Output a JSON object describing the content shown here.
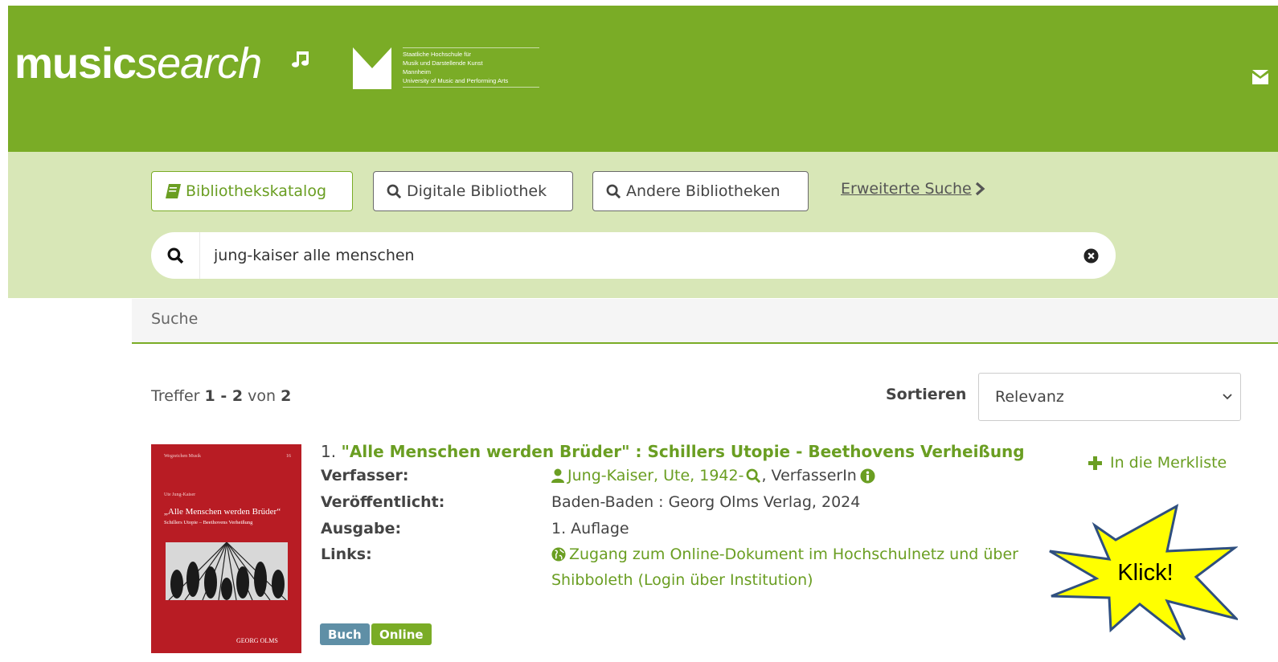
{
  "header": {
    "brand_bold": "music",
    "brand_italic": "search",
    "institution_lines": [
      "Staatliche Hochschule für",
      "Musik und Darstellende Kunst",
      "Mannheim",
      "University of Music and Performing Arts"
    ],
    "brand_color": "#7aac26"
  },
  "tabs": [
    {
      "label": "Bibliothekskatalog",
      "icon": "book-icon",
      "active": true
    },
    {
      "label": "Digitale Bibliothek",
      "icon": "search-icon",
      "active": false
    },
    {
      "label": "Andere Bibliotheken",
      "icon": "search-icon",
      "active": false
    }
  ],
  "advanced_search": "Erweiterte Suche",
  "search": {
    "value": "jung-kaiser alle menschen"
  },
  "breadcrumb": "Suche",
  "results_header": {
    "prefix": "Treffer",
    "range": "1 - 2",
    "of": "von",
    "total": "2",
    "sort_label": "Sortieren",
    "sort_value": "Relevanz"
  },
  "result": {
    "number": "1.",
    "title": "\"Alle Menschen werden Brüder\" : Schillers Utopie - Beethovens Verheißung",
    "fields": {
      "author_label": "Verfasser:",
      "author_name": "Jung-Kaiser, Ute, 1942-",
      "author_role": ", VerfasserIn",
      "published_label": "Veröffentlicht:",
      "published_value": "Baden-Baden : Georg Olms Verlag, 2024",
      "edition_label": "Ausgabe:",
      "edition_value": "1. Auflage",
      "links_label": "Links:",
      "link_line1": "Zugang zum Online-Dokument im Hochschulnetz und über",
      "link_line2": "Shibboleth (Login über Institution)"
    },
    "bookmark": "In die Merkliste",
    "badges": [
      "Buch",
      "Online"
    ],
    "cover": {
      "series": "Wegzeichen Musik",
      "volume": "16",
      "author": "Ute Jung-Kaiser",
      "title": "„Alle Menschen werden Brüder“",
      "subtitle": "Schillers Utopie – Beethovens Verheißung",
      "publisher": "GEORG OLMS"
    }
  },
  "callout": "Klick!"
}
